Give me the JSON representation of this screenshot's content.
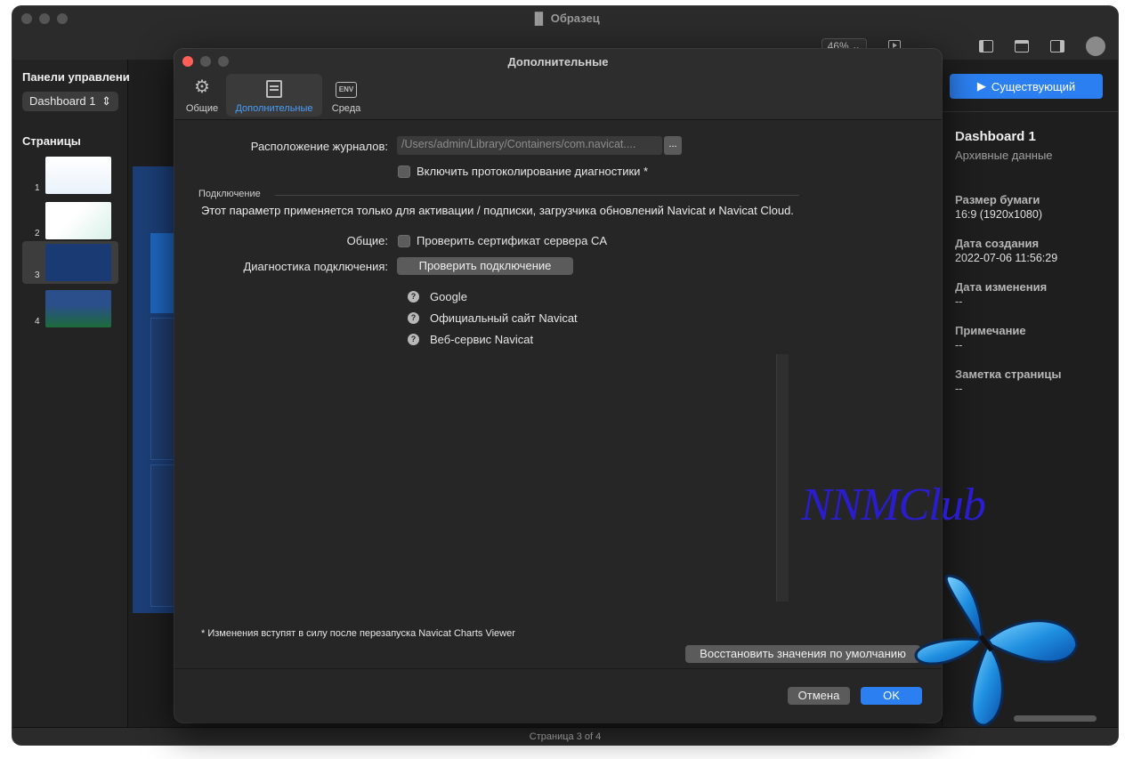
{
  "window": {
    "title": "Образец",
    "zoom": "46% ⌄",
    "accent": "#2c7ff0"
  },
  "sidebar": {
    "title": "Панели управлени",
    "dashboard_select": "Dashboard 1",
    "pages_title": "Страницы",
    "pages": [
      {
        "num": "1"
      },
      {
        "num": "2"
      },
      {
        "num": "3",
        "selected": true
      },
      {
        "num": "4"
      }
    ]
  },
  "right_panel": {
    "existing_button": "Существующий",
    "name": "Dashboard 1",
    "subtitle": "Архивные данные",
    "paper_size_label": "Размер бумаги",
    "paper_size_value": "16:9 (1920x1080)",
    "created_label": "Дата создания",
    "created_value": "2022-07-06 11:56:29",
    "modified_label": "Дата изменения",
    "modified_value": "--",
    "note_label": "Примечание",
    "note_value": "--",
    "page_note_label": "Заметка страницы",
    "page_note_value": "--"
  },
  "statusbar": {
    "text": "Страница 3 of 4"
  },
  "dialog": {
    "title": "Дополнительные",
    "tabs": [
      {
        "label": "Общие",
        "icon": "gear-icon"
      },
      {
        "label": "Дополнительные",
        "icon": "document-icon",
        "selected": true
      },
      {
        "label": "Среда",
        "icon": "env-icon",
        "icon_text": "ENV"
      }
    ],
    "log_location_label": "Расположение журналов:",
    "log_location_value": "/Users/admin/Library/Containers/com.navicat....",
    "browse_button": "...",
    "enable_diag_label": "Включить протоколирование диагностики *",
    "connection_section": "Подключение",
    "connection_text": "Этот параметр применяется только для активации / подписки, загрузчика обновлений Navicat и Navicat Cloud.",
    "general_label": "Общие:",
    "verify_cert_label": "Проверить сертификат сервера CA",
    "diag_label": "Диагностика подключения:",
    "check_connection_button": "Проверить подключение",
    "diag_targets": [
      "Google",
      "Официальный сайт Navicat",
      "Веб-сервис Navicat"
    ],
    "restart_note": "* Изменения вступят в силу после перезапуска Navicat Charts Viewer",
    "restore_defaults_button": "Восстановить значения по умолчанию",
    "cancel_button": "Отмена",
    "ok_button": "OK"
  },
  "watermark": {
    "text": "NNMClub"
  }
}
